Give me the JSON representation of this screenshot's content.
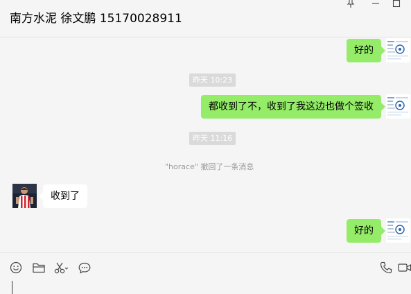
{
  "header": {
    "title": "南方水泥 徐文鹏 15170028911",
    "window_buttons": [
      {
        "icon": "pin-icon"
      },
      {
        "icon": "minimize-icon"
      },
      {
        "icon": "maximize-icon"
      }
    ]
  },
  "messages": [
    {
      "type": "text",
      "sender": "me",
      "text": "好的"
    },
    {
      "type": "time",
      "text": "昨天 10:23"
    },
    {
      "type": "text",
      "sender": "me",
      "text": "都收到了不，收到了我这边也做个签收"
    },
    {
      "type": "time",
      "text": "昨天 11:16"
    },
    {
      "type": "recall",
      "text": "\"horace\" 撤回了一条消息"
    },
    {
      "type": "text",
      "sender": "other",
      "text": "收到了"
    },
    {
      "type": "text",
      "sender": "me",
      "text": "好的"
    }
  ],
  "toolbar": {
    "left_tools": [
      "emoji-icon",
      "folder-icon",
      "scissors-icon",
      "chat-bubble-icon"
    ],
    "right_tools": [
      "phone-icon",
      "video-icon"
    ]
  },
  "colors": {
    "background": "#f5f5f5",
    "my_bubble": "#95ec69",
    "other_bubble": "#ffffff",
    "time_chip": "#dadada",
    "notice_text": "#9a9a9a"
  }
}
